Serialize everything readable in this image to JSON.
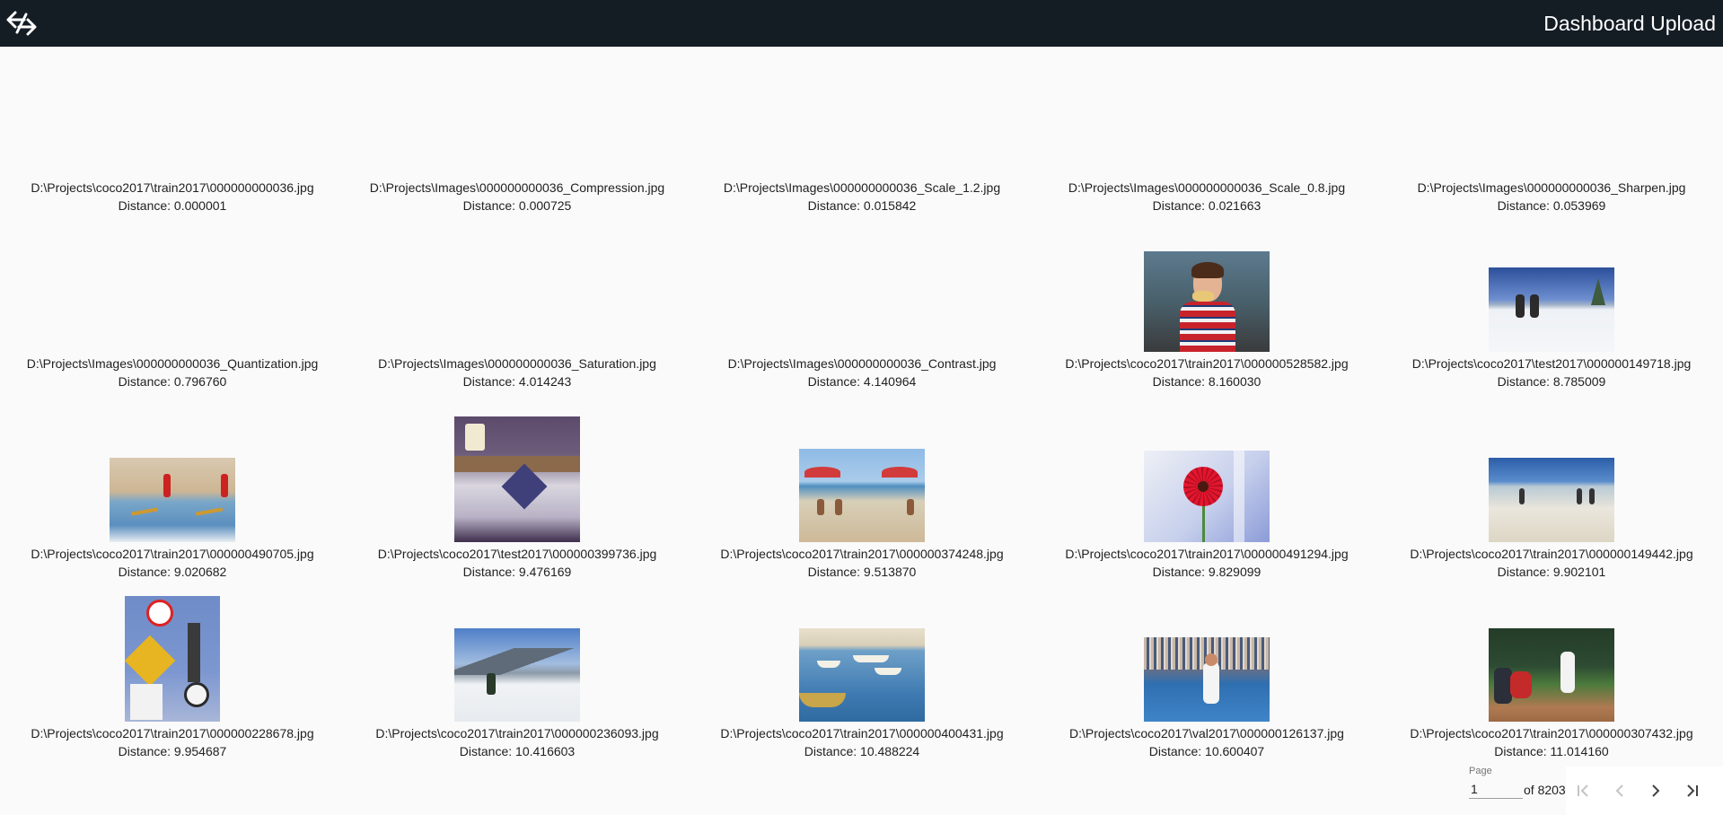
{
  "header": {
    "title": "Dashboard Upload",
    "logo_icon": "app-logo-icon"
  },
  "results": [
    {
      "path": "D:\\Projects\\coco2017\\train2017\\000000000036.jpg",
      "distance": "Distance: 0.000001",
      "thumb": "umbrella"
    },
    {
      "path": "D:\\Projects\\Images\\000000000036_Compression.jpg",
      "distance": "Distance: 0.000725",
      "thumb": "umbrella"
    },
    {
      "path": "D:\\Projects\\Images\\000000000036_Scale_1.2.jpg",
      "distance": "Distance: 0.015842",
      "thumb": "umbrella"
    },
    {
      "path": "D:\\Projects\\Images\\000000000036_Scale_0.8.jpg",
      "distance": "Distance: 0.021663",
      "thumb": "umbrella"
    },
    {
      "path": "D:\\Projects\\Images\\000000000036_Sharpen.jpg",
      "distance": "Distance: 0.053969",
      "thumb": "umbrella"
    },
    {
      "path": "D:\\Projects\\Images\\000000000036_Quantization.jpg",
      "distance": "Distance: 0.796760",
      "thumb": "umbrella"
    },
    {
      "path": "D:\\Projects\\Images\\000000000036_Saturation.jpg",
      "distance": "Distance: 4.014243",
      "thumb": "umbrella"
    },
    {
      "path": "D:\\Projects\\Images\\000000000036_Contrast.jpg",
      "distance": "Distance: 4.140964",
      "thumb": "umbrella"
    },
    {
      "path": "D:\\Projects\\coco2017\\train2017\\000000528582.jpg",
      "distance": "Distance: 8.160030",
      "thumb": "boy"
    },
    {
      "path": "D:\\Projects\\coco2017\\test2017\\000000149718.jpg",
      "distance": "Distance: 8.785009",
      "thumb": "snow1"
    },
    {
      "path": "D:\\Projects\\coco2017\\train2017\\000000490705.jpg",
      "distance": "Distance: 9.020682",
      "thumb": "surf"
    },
    {
      "path": "D:\\Projects\\coco2017\\test2017\\000000399736.jpg",
      "distance": "Distance: 9.476169",
      "thumb": "bed"
    },
    {
      "path": "D:\\Projects\\coco2017\\train2017\\000000374248.jpg",
      "distance": "Distance: 9.513870",
      "thumb": "beach"
    },
    {
      "path": "D:\\Projects\\coco2017\\train2017\\000000491294.jpg",
      "distance": "Distance: 9.829099",
      "thumb": "flower"
    },
    {
      "path": "D:\\Projects\\coco2017\\train2017\\000000149442.jpg",
      "distance": "Distance: 9.902101",
      "thumb": "sand"
    },
    {
      "path": "D:\\Projects\\coco2017\\train2017\\000000228678.jpg",
      "distance": "Distance: 9.954687",
      "thumb": "sign"
    },
    {
      "path": "D:\\Projects\\coco2017\\train2017\\000000236093.jpg",
      "distance": "Distance: 10.416603",
      "thumb": "ski"
    },
    {
      "path": "D:\\Projects\\coco2017\\train2017\\000000400431.jpg",
      "distance": "Distance: 10.488224",
      "thumb": "boats"
    },
    {
      "path": "D:\\Projects\\coco2017\\val2017\\000000126137.jpg",
      "distance": "Distance: 10.600407",
      "thumb": "tennis"
    },
    {
      "path": "D:\\Projects\\coco2017\\train2017\\000000307432.jpg",
      "distance": "Distance: 11.014160",
      "thumb": "baseball"
    }
  ],
  "pagination": {
    "page_label": "Page",
    "page_value": "1",
    "of_text": "of 8203",
    "first_icon": "first-page-icon",
    "prev_icon": "chevron-left-icon",
    "next_icon": "chevron-right-icon",
    "last_icon": "last-page-icon"
  },
  "colors": {
    "header_bg": "#141c24",
    "page_bg": "#fafafa",
    "text": "#212121"
  }
}
